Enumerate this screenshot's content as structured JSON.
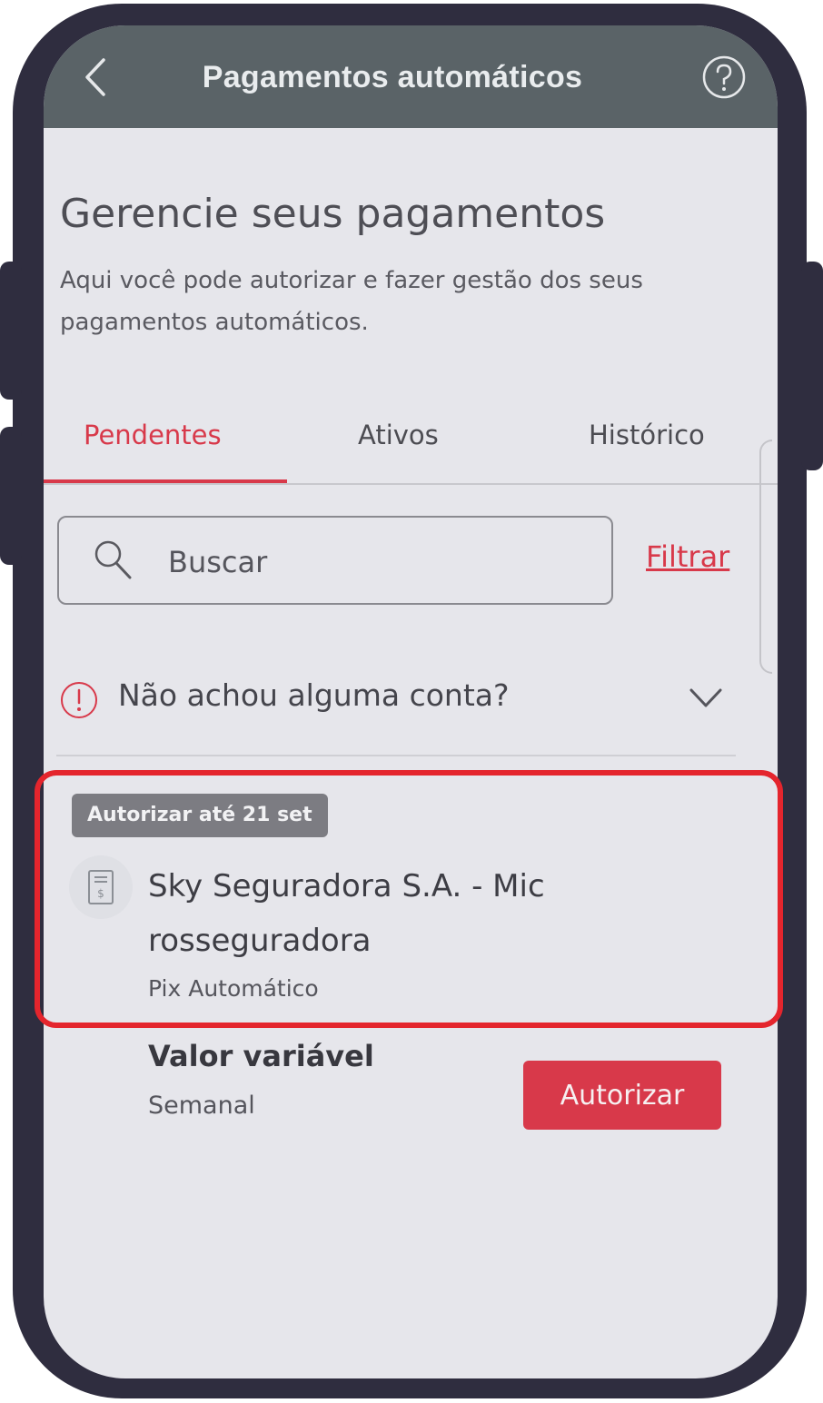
{
  "header": {
    "title": "Pagamentos automáticos",
    "back_icon": "chevron-left-icon",
    "help_icon": "help-circle-icon"
  },
  "main": {
    "heading": "Gerencie seus pagamentos",
    "description": "Aqui você pode autorizar e fazer gestão dos seus pagamentos automáticos."
  },
  "tabs": [
    {
      "label": "Pendentes",
      "active": true
    },
    {
      "label": "Ativos",
      "active": false
    },
    {
      "label": "Histórico",
      "active": false
    }
  ],
  "search": {
    "placeholder": "Buscar",
    "value": "",
    "filter_label": "Filtrar"
  },
  "info": {
    "text": "Não achou alguma conta?",
    "icon": "info-circle-icon"
  },
  "payment": {
    "badge": "Autorizar até 21 set",
    "company": "Sky Seguradora S.A. - Mic rosseguradora",
    "company_line1": "Sky Seguradora S.A. - Mic",
    "company_line2": "rosseguradora",
    "type": "Pix Automático",
    "amount_label": "Valor variável",
    "frequency": "Semanal",
    "button_label": "Autorizar",
    "icon": "receipt-icon"
  },
  "colors": {
    "accent": "#d8394a",
    "header_bg": "#5a6367",
    "highlight": "#e4252d",
    "frame": "#2f2d3f"
  }
}
